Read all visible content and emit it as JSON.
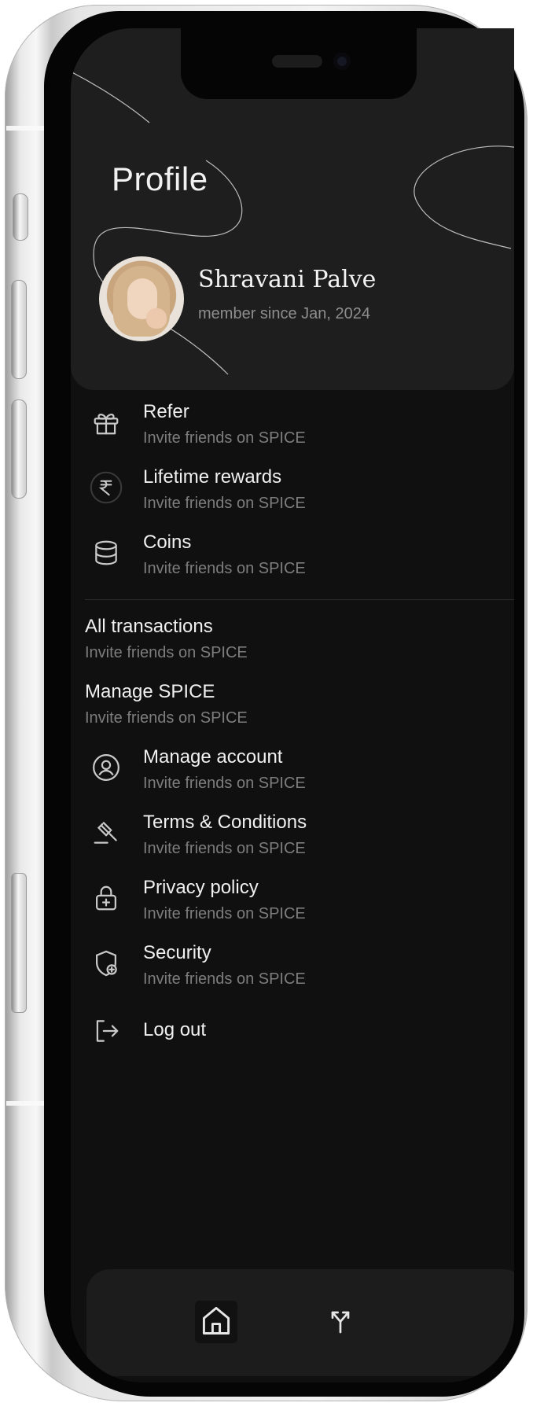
{
  "header": {
    "title": "Profile"
  },
  "user": {
    "name": "Shravani Palve",
    "member_since": "member since Jan, 2024"
  },
  "menu": {
    "refer": {
      "title": "Refer",
      "subtitle": "Invite friends on SPICE",
      "icon": "gift-icon"
    },
    "lifetime_rewards": {
      "title": "Lifetime rewards",
      "subtitle": "Invite friends on SPICE",
      "icon": "rupee-icon"
    },
    "coins": {
      "title": "Coins",
      "subtitle": "Invite friends on SPICE",
      "icon": "coins-icon"
    },
    "all_transactions": {
      "title": "All transactions",
      "subtitle": "Invite friends on SPICE"
    },
    "manage_spice": {
      "title": "Manage SPICE",
      "subtitle": "Invite friends on SPICE"
    },
    "manage_account": {
      "title": "Manage account",
      "subtitle": "Invite friends on SPICE",
      "icon": "user-circle-icon"
    },
    "terms": {
      "title": "Terms & Conditions",
      "subtitle": "Invite friends on SPICE",
      "icon": "gavel-icon"
    },
    "privacy": {
      "title": "Privacy policy",
      "subtitle": "Invite friends on SPICE",
      "icon": "lock-icon"
    },
    "security": {
      "title": "Security",
      "subtitle": "Invite friends on SPICE",
      "icon": "shield-plus-icon"
    },
    "logout": {
      "title": "Log out",
      "icon": "logout-icon"
    }
  },
  "nav": {
    "items": [
      "home-icon",
      "route-split-icon",
      "active-tab"
    ]
  },
  "colors": {
    "screen_bg": "#101010",
    "header_bg": "#1e1e1e",
    "text_primary": "#f0f0f0",
    "text_secondary": "#7d7d7d"
  }
}
